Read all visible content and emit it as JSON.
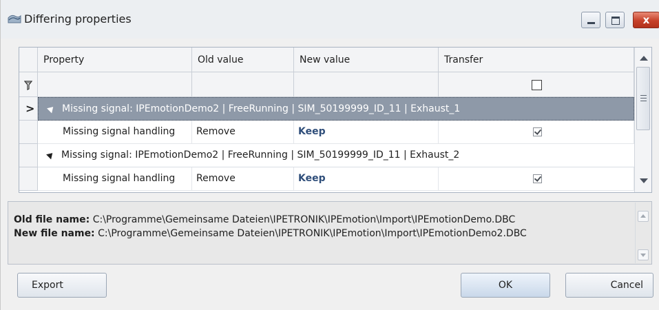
{
  "window": {
    "title": "Differing properties",
    "close_glyph": "x"
  },
  "grid": {
    "columns": [
      "Property",
      "Old value",
      "New value",
      "Transfer"
    ],
    "groups": [
      {
        "label": "Missing signal: IPEmotionDemo2 | FreeRunning | SIM_50199999_ID_11 | Exhaust_1",
        "selected": true,
        "row": {
          "property": "Missing signal handling",
          "old_value": "Remove",
          "new_value": "Keep",
          "transfer": true
        }
      },
      {
        "label": "Missing signal: IPEmotionDemo2 | FreeRunning | SIM_50199999_ID_11 | Exhaust_2",
        "selected": false,
        "row": {
          "property": "Missing signal handling",
          "old_value": "Remove",
          "new_value": "Keep",
          "transfer": true
        }
      }
    ],
    "filter_transfer_checked": false,
    "current_row_glyph": ">"
  },
  "info": {
    "old_label": "Old file name:",
    "old_value": "C:\\Programme\\Gemeinsame Dateien\\IPETRONIK\\IPEmotion\\Import\\IPEmotionDemo.DBC",
    "new_label": "New file name:",
    "new_value": "C:\\Programme\\Gemeinsame Dateien\\IPETRONIK\\IPEmotion\\Import\\IPEmotionDemo2.DBC"
  },
  "buttons": {
    "export": "Export",
    "ok": "OK",
    "cancel": "Cancel"
  },
  "colors": {
    "selected_row": "#8e99a8",
    "keep_text": "#2f4e7a",
    "close_button": "#c6412a"
  },
  "icons": [
    "app-icon",
    "filter-icon",
    "minimize-icon",
    "maximize-icon",
    "close-icon",
    "checkbox-icon",
    "scroll-up-icon",
    "scroll-down-icon"
  ]
}
